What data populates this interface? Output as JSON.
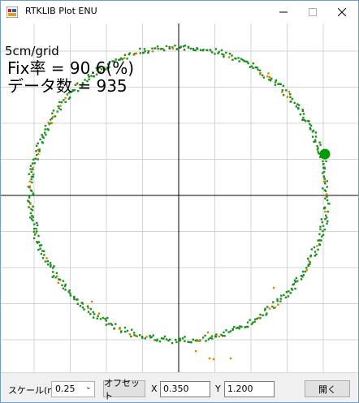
{
  "window": {
    "title": "RTKLIB Plot ENU"
  },
  "plot": {
    "grid_label": "5cm/grid",
    "fix_ratio_label": "Fix率 = 90.6(%)",
    "data_count_label": "データ数 = 935",
    "colors": {
      "fix_point": "#1e8c1e",
      "float_point": "#e08000",
      "current_point": "#009a00",
      "grid": "#d4d4d4",
      "axis": "#000000"
    }
  },
  "toolbar": {
    "scale_label": "スケール(m)",
    "scale_value": "0.25",
    "offset_button": "オフセット",
    "x_label": "X",
    "x_value": "0.350",
    "y_label": "Y",
    "y_value": "1.200",
    "open_button": "開く"
  },
  "icons": {
    "app": "rtklib-app-icon",
    "minimize": "minimize-icon",
    "maximize": "maximize-icon",
    "close": "close-icon",
    "dropdown": "chevron-down-icon"
  }
}
